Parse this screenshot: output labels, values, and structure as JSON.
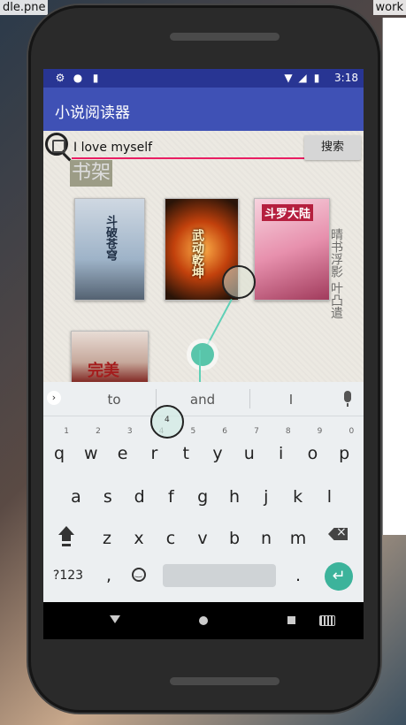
{
  "background": {
    "file_left": "dle.pne",
    "file_right": "work"
  },
  "statusbar": {
    "icons": [
      "gear-icon",
      "circle-icon",
      "sd-card-icon",
      "wifi-icon",
      "signal-icon",
      "battery-icon"
    ],
    "time": "3:18",
    "color": "#283593"
  },
  "appbar": {
    "title": "小说阅读器",
    "color": "#3f51b5"
  },
  "search": {
    "value": "I love myself",
    "button_label": "搜索",
    "underline_color": "#e91e63"
  },
  "shelf": {
    "title": "书架",
    "books": [
      {
        "cover_text": "斗破苍穹"
      },
      {
        "cover_text": "武动乾坤"
      },
      {
        "cover_text": "斗罗大陆"
      },
      {
        "cover_text": "完美"
      }
    ],
    "calligraphy": "晴书浮影 叶凸遣"
  },
  "keyboard": {
    "suggestions": [
      "to",
      "and",
      "I"
    ],
    "row1": [
      {
        "key": "q",
        "num": "1"
      },
      {
        "key": "w",
        "num": "2"
      },
      {
        "key": "e",
        "num": "3"
      },
      {
        "key": "r",
        "num": "4"
      },
      {
        "key": "t",
        "num": "5"
      },
      {
        "key": "y",
        "num": "6"
      },
      {
        "key": "u",
        "num": "7"
      },
      {
        "key": "i",
        "num": "8"
      },
      {
        "key": "o",
        "num": "9"
      },
      {
        "key": "p",
        "num": "0"
      }
    ],
    "row2": [
      "a",
      "s",
      "d",
      "f",
      "g",
      "h",
      "j",
      "k",
      "l"
    ],
    "row3": [
      "z",
      "x",
      "c",
      "v",
      "b",
      "n",
      "m"
    ],
    "symbols_label": "?123",
    "comma": ",",
    "period": ".",
    "enter_color": "#3cb39b"
  },
  "selection": {
    "magnifier_label": "4"
  }
}
